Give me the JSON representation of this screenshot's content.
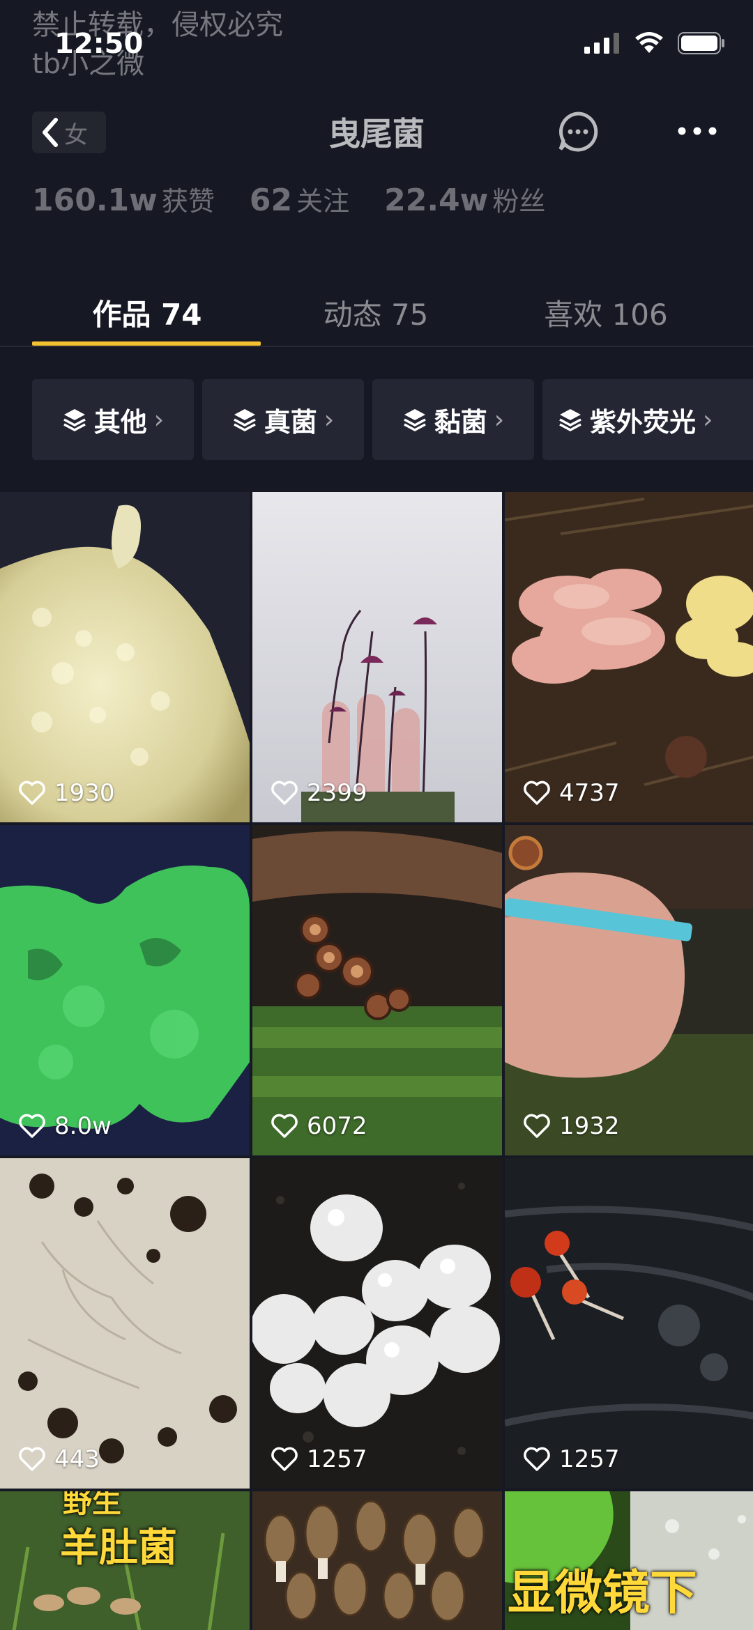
{
  "watermark": {
    "line1": "禁止转载，侵权必究",
    "line2": "tb小之微"
  },
  "status": {
    "time": "12:50"
  },
  "header": {
    "back_tag": "女",
    "title": "曳尾菌"
  },
  "stats": [
    {
      "value": "160.1w",
      "label": "获赞"
    },
    {
      "value": "62",
      "label": "关注"
    },
    {
      "value": "22.4w",
      "label": "粉丝"
    }
  ],
  "tabs": [
    {
      "label": "作品 74"
    },
    {
      "label": "动态 75"
    },
    {
      "label": "喜欢 106"
    }
  ],
  "chips": [
    {
      "label": "其他"
    },
    {
      "label": "真菌"
    },
    {
      "label": "黏菌"
    },
    {
      "label": "紫外荧光"
    }
  ],
  "videos": [
    {
      "likes": "1930"
    },
    {
      "likes": "2399"
    },
    {
      "likes": "4737"
    },
    {
      "likes": "8.0w"
    },
    {
      "likes": "6072"
    },
    {
      "likes": "1932"
    },
    {
      "likes": "443"
    },
    {
      "likes": "1257"
    },
    {
      "likes": "1257"
    }
  ],
  "bottom_overlays": {
    "morel_title": "羊肚菌",
    "morel_top": "野生",
    "micro": "显微镜下"
  },
  "colors": {
    "background": "#161823",
    "accent": "#f4c230",
    "chip": "#242634"
  }
}
